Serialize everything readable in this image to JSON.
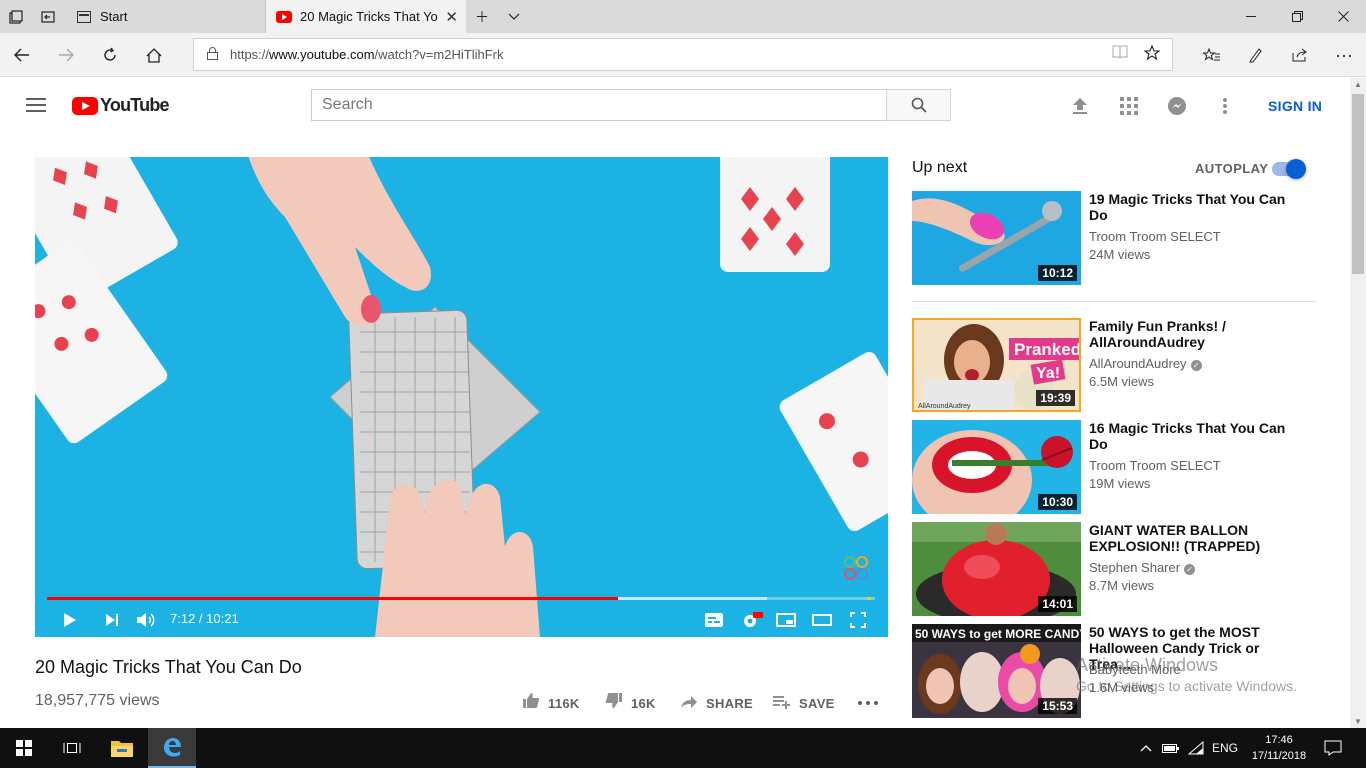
{
  "browser": {
    "tabs": [
      {
        "label": "Start",
        "active": false
      },
      {
        "label": "20 Magic Tricks That Yo",
        "active": true
      }
    ],
    "url_prefix": "https://",
    "url_host": "www.youtube.com",
    "url_path": "/watch?v=m2HiTlihFrk"
  },
  "youtube": {
    "logo_text": "YouTube",
    "search_placeholder": "Search",
    "sign_in": "SIGN IN"
  },
  "video": {
    "title": "20 Magic Tricks That You Can Do",
    "views": "18,957,775 views",
    "time": "7:12 / 10:21",
    "progress": 0.69,
    "likes": "116K",
    "dislikes": "16K",
    "share": "SHARE",
    "save": "SAVE",
    "accent": "#ff0000"
  },
  "sidebar": {
    "up_next": "Up next",
    "autoplay": "AUTOPLAY",
    "autoplay_on": true,
    "items": [
      {
        "title": "19 Magic Tricks That You Can Do",
        "channel": "Troom Troom SELECT",
        "views": "24M views",
        "duration": "10:12",
        "verified": false
      },
      {
        "title": "Family Fun Pranks! / AllAroundAudrey",
        "channel": "AllAroundAudrey",
        "views": "6.5M views",
        "duration": "19:39",
        "verified": true
      },
      {
        "title": "16 Magic Tricks That You Can Do",
        "channel": "Troom Troom SELECT",
        "views": "19M views",
        "duration": "10:30",
        "verified": false
      },
      {
        "title": "GIANT WATER BALLON EXPLOSION!! (TRAPPED)",
        "channel": "Stephen Sharer",
        "views": "8.7M views",
        "duration": "14:01",
        "verified": true
      },
      {
        "title": "50 WAYS to get the MOST Halloween Candy Trick or Trea…",
        "channel": "Babyteeth More",
        "views": "1.6M views",
        "duration": "15:53",
        "verified": false
      }
    ],
    "thumb_text": {
      "pranked": "Pranked",
      "ya": "Ya!",
      "allaround": "AllAroundAudrey",
      "candy": "50 WAYS to get MORE CANDY!"
    }
  },
  "watermark": {
    "line1": "Activate Windows",
    "line2": "Go to Settings to activate Windows."
  },
  "taskbar": {
    "language": "ENG",
    "time": "17:46",
    "date": "17/11/2018"
  }
}
